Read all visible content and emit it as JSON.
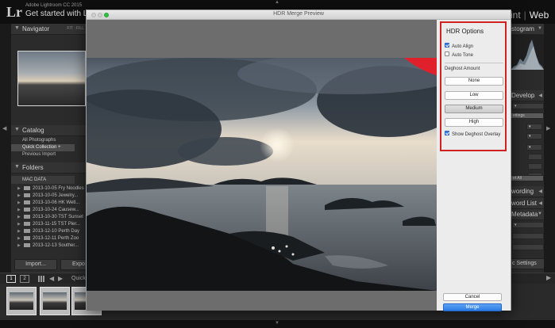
{
  "lightroom": {
    "logo": "Lr",
    "app_name": "Adobe Lightroom CC 2015",
    "catalog_title": "Get started with Ligh",
    "modules": {
      "print": "rint",
      "web": "Web"
    },
    "left_panel": {
      "navigator": {
        "title": "Navigator",
        "fit": "FIT",
        "fill": "FILL"
      },
      "catalog": {
        "title": "Catalog",
        "items": [
          "All Photographs",
          "Quick Collection +",
          "Previous Import"
        ]
      },
      "folders": {
        "title": "Folders",
        "drive": "MAC DATA",
        "items": [
          "2013-10-05 Fry Noodles",
          "2013-10-05 Jewelry...",
          "2013-10-06 HK Wetl...",
          "2013-10-24 Causew...",
          "2013-10-30 TST Sunset",
          "2013-11-15 TST Pier...",
          "2013-12-10 Perth Day",
          "2013-12-11 Perth Zoo",
          "2013-12-13 Souther..."
        ]
      },
      "import_label": "Import...",
      "export_label": "Expo"
    },
    "right_panel": {
      "histogram": "stogram",
      "develop": "Develop",
      "settings_frag": "ettings",
      "reset_frag": "et All",
      "keywording": "wording",
      "keyword_list": "word List",
      "metadata": "Metadata",
      "sync_settings": "c Settings"
    },
    "toolbar": {
      "page1": "1",
      "page2": "2",
      "quick": "Quick"
    }
  },
  "dialog": {
    "title": "HDR Merge Preview",
    "options": {
      "title": "HDR Options",
      "auto_align": {
        "label": "Auto Align",
        "checked": true
      },
      "auto_tone": {
        "label": "Auto Tone",
        "checked": false
      },
      "deghost_label": "Deghost Amount",
      "deghost_buttons": [
        "None",
        "Low",
        "Medium",
        "High"
      ],
      "deghost_selected": "Medium",
      "show_overlay": {
        "label": "Show Deghost Overlay",
        "checked": true
      }
    },
    "cancel_label": "Cancel",
    "merge_label": "Merge"
  },
  "colors": {
    "highlight_border": "#d12121",
    "merge_button": "#2c7be3",
    "overlay": "#e0202a"
  }
}
